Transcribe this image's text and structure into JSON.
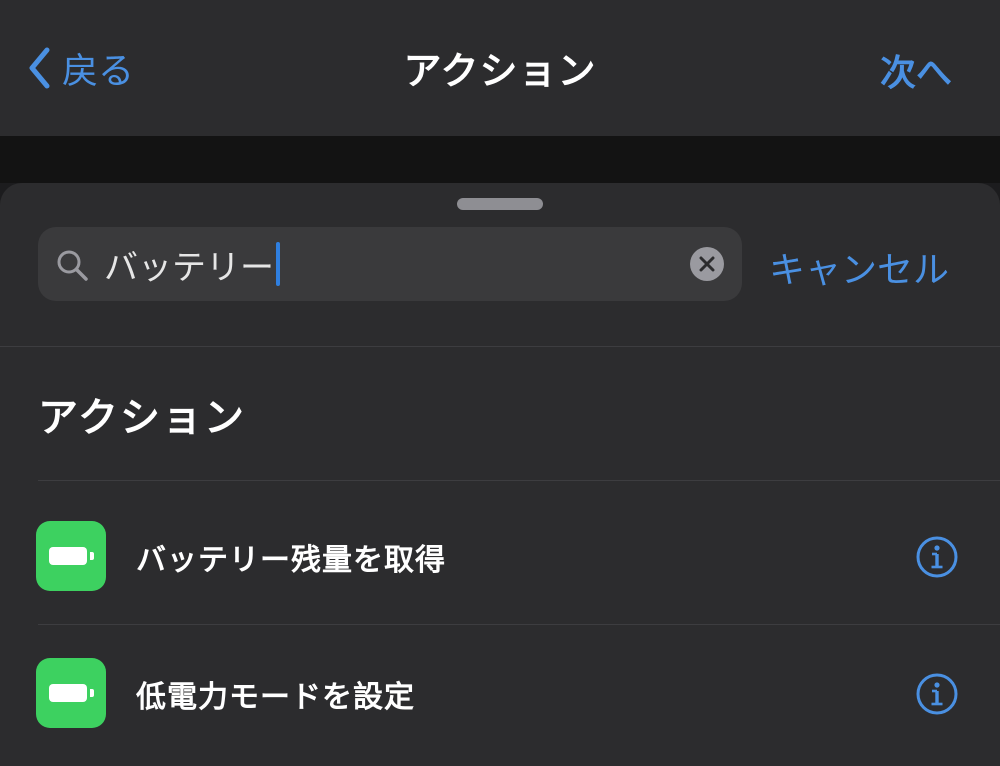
{
  "nav": {
    "back_label": "戻る",
    "title": "アクション",
    "next_label": "次へ"
  },
  "search": {
    "query": "バッテリー",
    "cancel_label": "キャンセル"
  },
  "section": {
    "header": "アクション"
  },
  "actions": [
    {
      "label": "バッテリー残量を取得",
      "icon": "battery-icon"
    },
    {
      "label": "低電力モードを設定",
      "icon": "battery-icon"
    }
  ],
  "colors": {
    "accent": "#4a90e2",
    "icon_green": "#3dd160",
    "background": "#2c2c2e"
  }
}
